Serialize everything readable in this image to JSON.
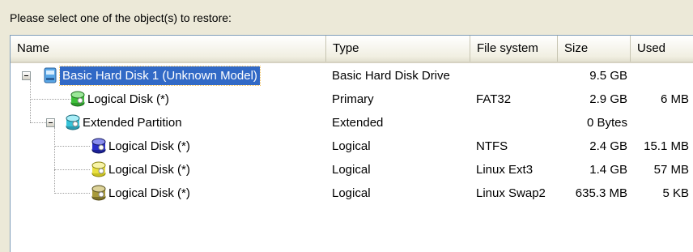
{
  "prompt": "Please select one of the object(s) to restore:",
  "columns": {
    "name": "Name",
    "type": "Type",
    "fs": "File system",
    "size": "Size",
    "used": "Used"
  },
  "rows": [
    {
      "name": "Basic Hard Disk 1 (Unknown Model)",
      "type": "Basic Hard Disk Drive",
      "fs": "",
      "size": "9.5 GB",
      "used": "",
      "icon": "hard-disk-icon"
    },
    {
      "name": "Logical Disk (*)",
      "type": "Primary",
      "fs": "FAT32",
      "size": "2.9 GB",
      "used": "6 MB",
      "icon": "green-partition-icon",
      "icon_color": "#3ec03a"
    },
    {
      "name": "Extended Partition",
      "type": "Extended",
      "fs": "",
      "size": "0 Bytes",
      "used": "",
      "icon": "cyan-partition-icon",
      "icon_color": "#36c3d8"
    },
    {
      "name": "Logical Disk (*)",
      "type": "Logical",
      "fs": "NTFS",
      "size": "2.4 GB",
      "used": "15.1 MB",
      "icon": "blue-partition-icon",
      "icon_color": "#2a2fc8"
    },
    {
      "name": "Logical Disk (*)",
      "type": "Logical",
      "fs": "Linux Ext3",
      "size": "1.4 GB",
      "used": "57 MB",
      "icon": "yellow-partition-icon",
      "icon_color": "#e8e040"
    },
    {
      "name": "Logical Disk (*)",
      "type": "Logical",
      "fs": "Linux Swap2",
      "size": "635.3 MB",
      "used": "5 KB",
      "icon": "olive-partition-icon",
      "icon_color": "#a89a3a"
    }
  ]
}
